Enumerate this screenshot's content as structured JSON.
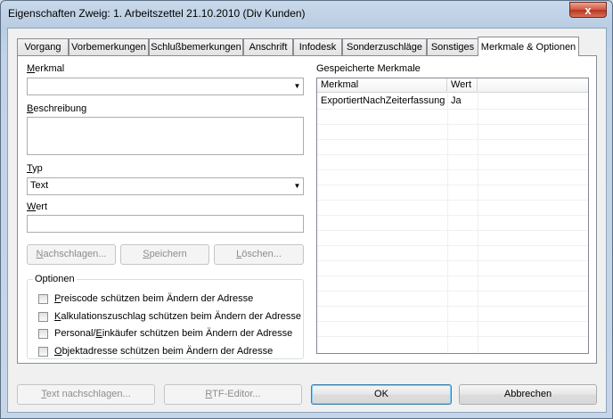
{
  "window": {
    "title": "Eigenschaften Zweig: 1. Arbeitszettel 21.10.2010 (Div Kunden)",
    "close_glyph": "x"
  },
  "tabs": [
    {
      "label": "Vorgang"
    },
    {
      "label": "Vorbemerkungen"
    },
    {
      "label": "Schlußbemerkungen"
    },
    {
      "label": "Anschrift"
    },
    {
      "label": "Infodesk"
    },
    {
      "label": "Sonderzuschläge"
    },
    {
      "label": "Sonstiges"
    },
    {
      "label": "Merkmale & Optionen"
    }
  ],
  "form": {
    "merkmal_label_m": "M",
    "merkmal_label_rest": "erkmal",
    "merkmal_value": "",
    "beschreibung_label_b": "B",
    "beschreibung_label_rest": "eschreibung",
    "beschreibung_value": "",
    "typ_label_t": "T",
    "typ_label_rest": "yp",
    "typ_value": "Text",
    "wert_label_w": "W",
    "wert_label_rest": "ert",
    "wert_value": ""
  },
  "buttons": {
    "nachschlagen_n": "N",
    "nachschlagen_rest": "achschlagen...",
    "speichern_s": "S",
    "speichern_rest": "peichern",
    "loeschen_l": "L",
    "loeschen_rest": "öschen...",
    "text_nachschlagen_t": "T",
    "text_nachschlagen_rest": "ext nachschlagen...",
    "rtf_r": "R",
    "rtf_rest": "TF-Editor...",
    "ok": "OK",
    "abbrechen": "Abbrechen"
  },
  "options": {
    "legend": "Optionen",
    "items": [
      {
        "pre": "",
        "key": "P",
        "post": "reiscode schützen beim Ändern der Adresse",
        "checked": false
      },
      {
        "pre": "",
        "key": "K",
        "post": "alkulationszuschlag schützen beim Ändern der Adresse",
        "checked": false
      },
      {
        "pre": "Personal/",
        "key": "E",
        "post": "inkäufer schützen beim Ändern der Adresse",
        "checked": false
      },
      {
        "pre": "",
        "key": "O",
        "post": "bjektadresse schützen beim Ändern der Adresse",
        "checked": false
      }
    ]
  },
  "saved": {
    "label": "Gespeicherte Merkmale",
    "columns": [
      "Merkmal",
      "Wert"
    ],
    "rows": [
      {
        "merkmal": "ExportiertNachZeiterfassung",
        "wert": "Ja"
      }
    ]
  }
}
